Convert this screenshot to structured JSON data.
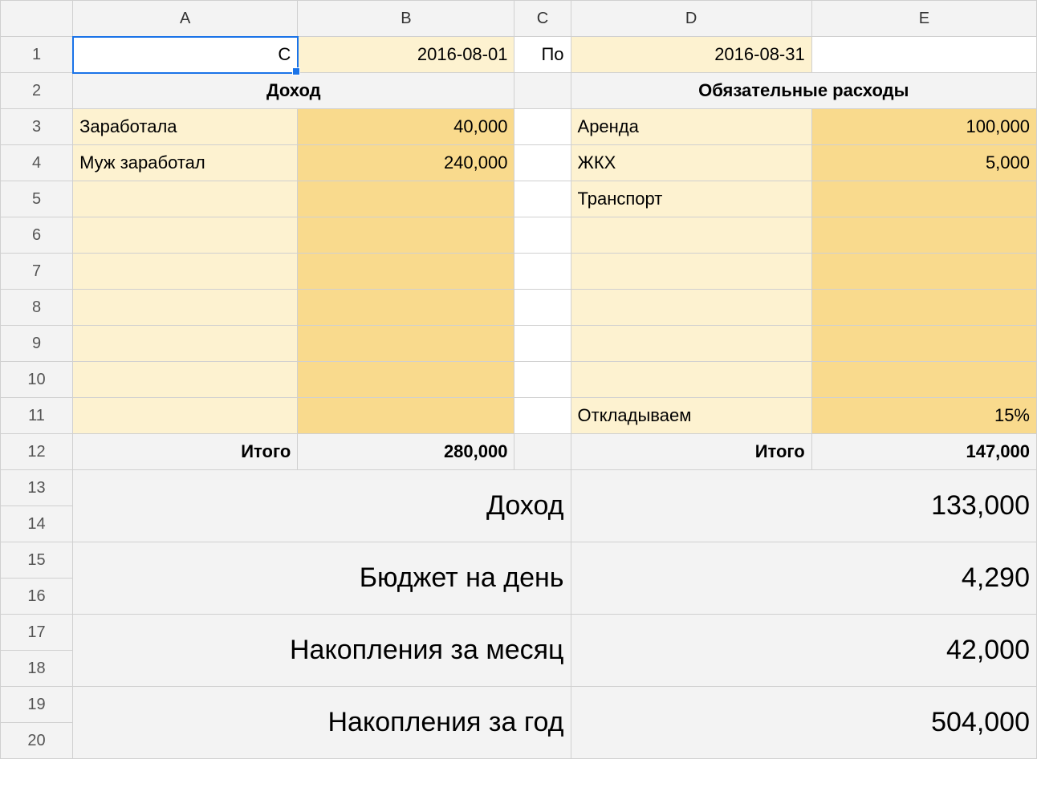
{
  "columns": [
    "A",
    "B",
    "C",
    "D",
    "E"
  ],
  "rowNumbers": [
    "1",
    "2",
    "3",
    "4",
    "5",
    "6",
    "7",
    "8",
    "9",
    "10",
    "11",
    "12",
    "13",
    "14",
    "15",
    "16",
    "17",
    "18",
    "19",
    "20"
  ],
  "row1": {
    "A": "С",
    "B": "2016-08-01",
    "C": "По",
    "D": "2016-08-31"
  },
  "headers": {
    "income": "Доход",
    "expenses": "Обязательные расходы"
  },
  "income": {
    "rows": [
      {
        "label": "Заработала",
        "value": "40,000"
      },
      {
        "label": "Муж заработал",
        "value": "240,000"
      }
    ],
    "totalLabel": "Итого",
    "totalValue": "280,000"
  },
  "expenses": {
    "rows": [
      {
        "label": "Аренда",
        "value": "100,000"
      },
      {
        "label": "ЖКХ",
        "value": "5,000"
      },
      {
        "label": "Транспорт",
        "value": ""
      }
    ],
    "save": {
      "label": "Откладываем",
      "value": "15%"
    },
    "totalLabel": "Итого",
    "totalValue": "147,000"
  },
  "summary": [
    {
      "label": "Доход",
      "value": "133,000"
    },
    {
      "label": "Бюджет на день",
      "value": "4,290"
    },
    {
      "label": "Накопления за месяц",
      "value": "42,000"
    },
    {
      "label": "Накопления за год",
      "value": "504,000"
    }
  ]
}
